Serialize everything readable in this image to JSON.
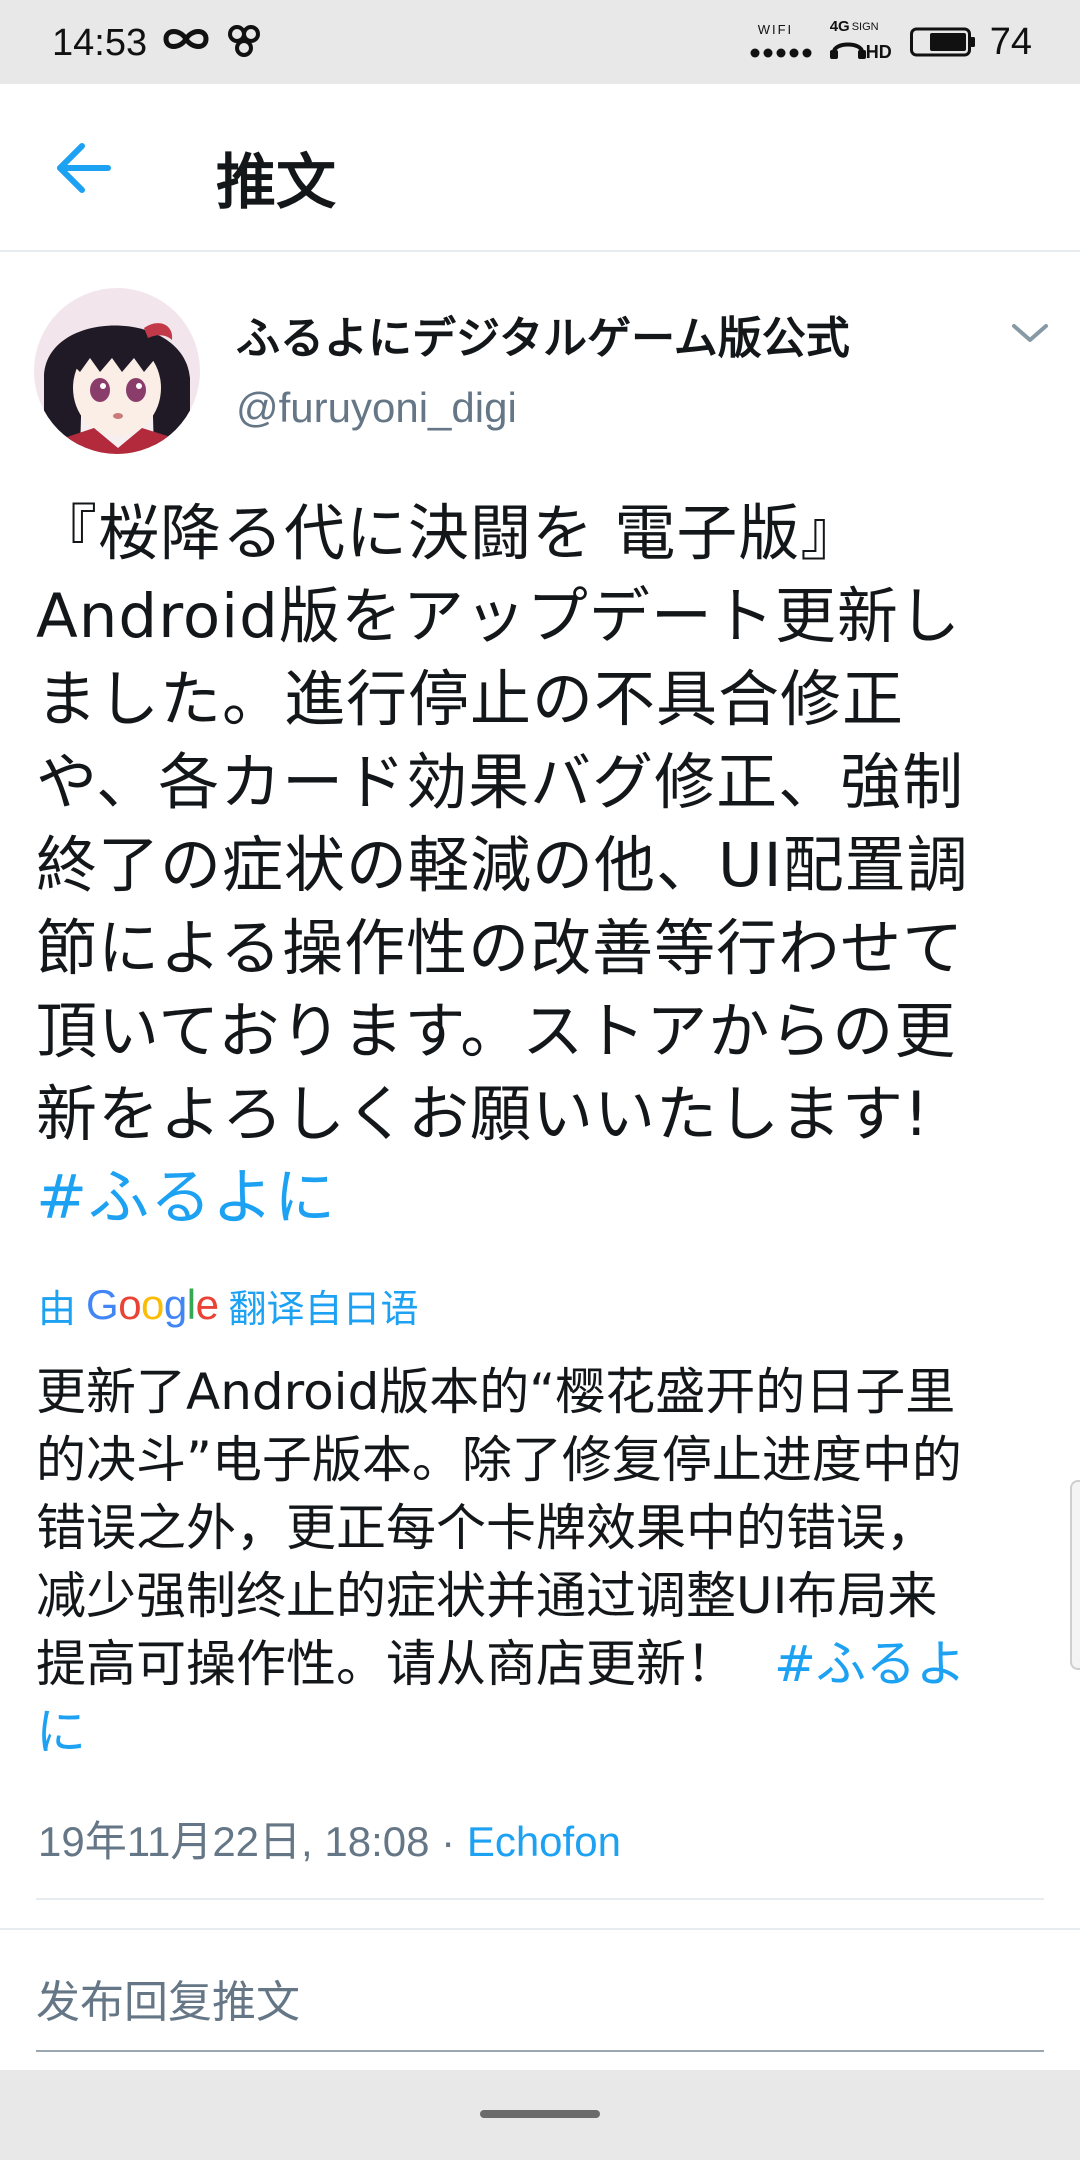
{
  "status_bar": {
    "time": "14:53",
    "wifi_label": "WIFI",
    "network_label": "4G",
    "sign_label": "SIGN",
    "hd_label": "HD",
    "battery": "74"
  },
  "app_bar": {
    "title": "推文"
  },
  "tweet": {
    "display_name": "ふるよにデジタルゲーム版公式",
    "handle": "@furuyoni_digi",
    "text_lines": [
      "『桜降る代に決闘を 電子版』",
      "Android版をアップデート更新し",
      "ました。進行停止の不具合修正",
      "や、各カード効果バグ修正、強制",
      "終了の症状の軽減の他、UI配置調",
      "節による操作性の改善等行わせて",
      "頂いております。ストアからの更",
      "新をよろしくお願いいたします!"
    ],
    "hashtag": "#ふるよに",
    "translation_prefix": "由",
    "translation_brand": "Google",
    "translation_suffix": "翻译自日语",
    "translation_lines": [
      "更新了Android版本的“樱花盛开的日子里",
      "的决斗”电子版本。除了修复停止进度中的",
      "错误之外，更正每个卡牌效果中的错误，",
      "减少强制终止的症状并通过调整UI布局来",
      "提高可操作性。请从商店更新！"
    ],
    "translation_hashtag_part1": "#ふるよ",
    "translation_hashtag_part2": "に",
    "timestamp": "19年11月22日, 18:08",
    "separator": " · ",
    "client": "Echofon"
  },
  "reply": {
    "placeholder": "发布回复推文"
  },
  "colors": {
    "accent": "#1da1f2",
    "text": "#14171a",
    "secondary": "#657786",
    "status_bar_bg": "#e8e8e8"
  }
}
